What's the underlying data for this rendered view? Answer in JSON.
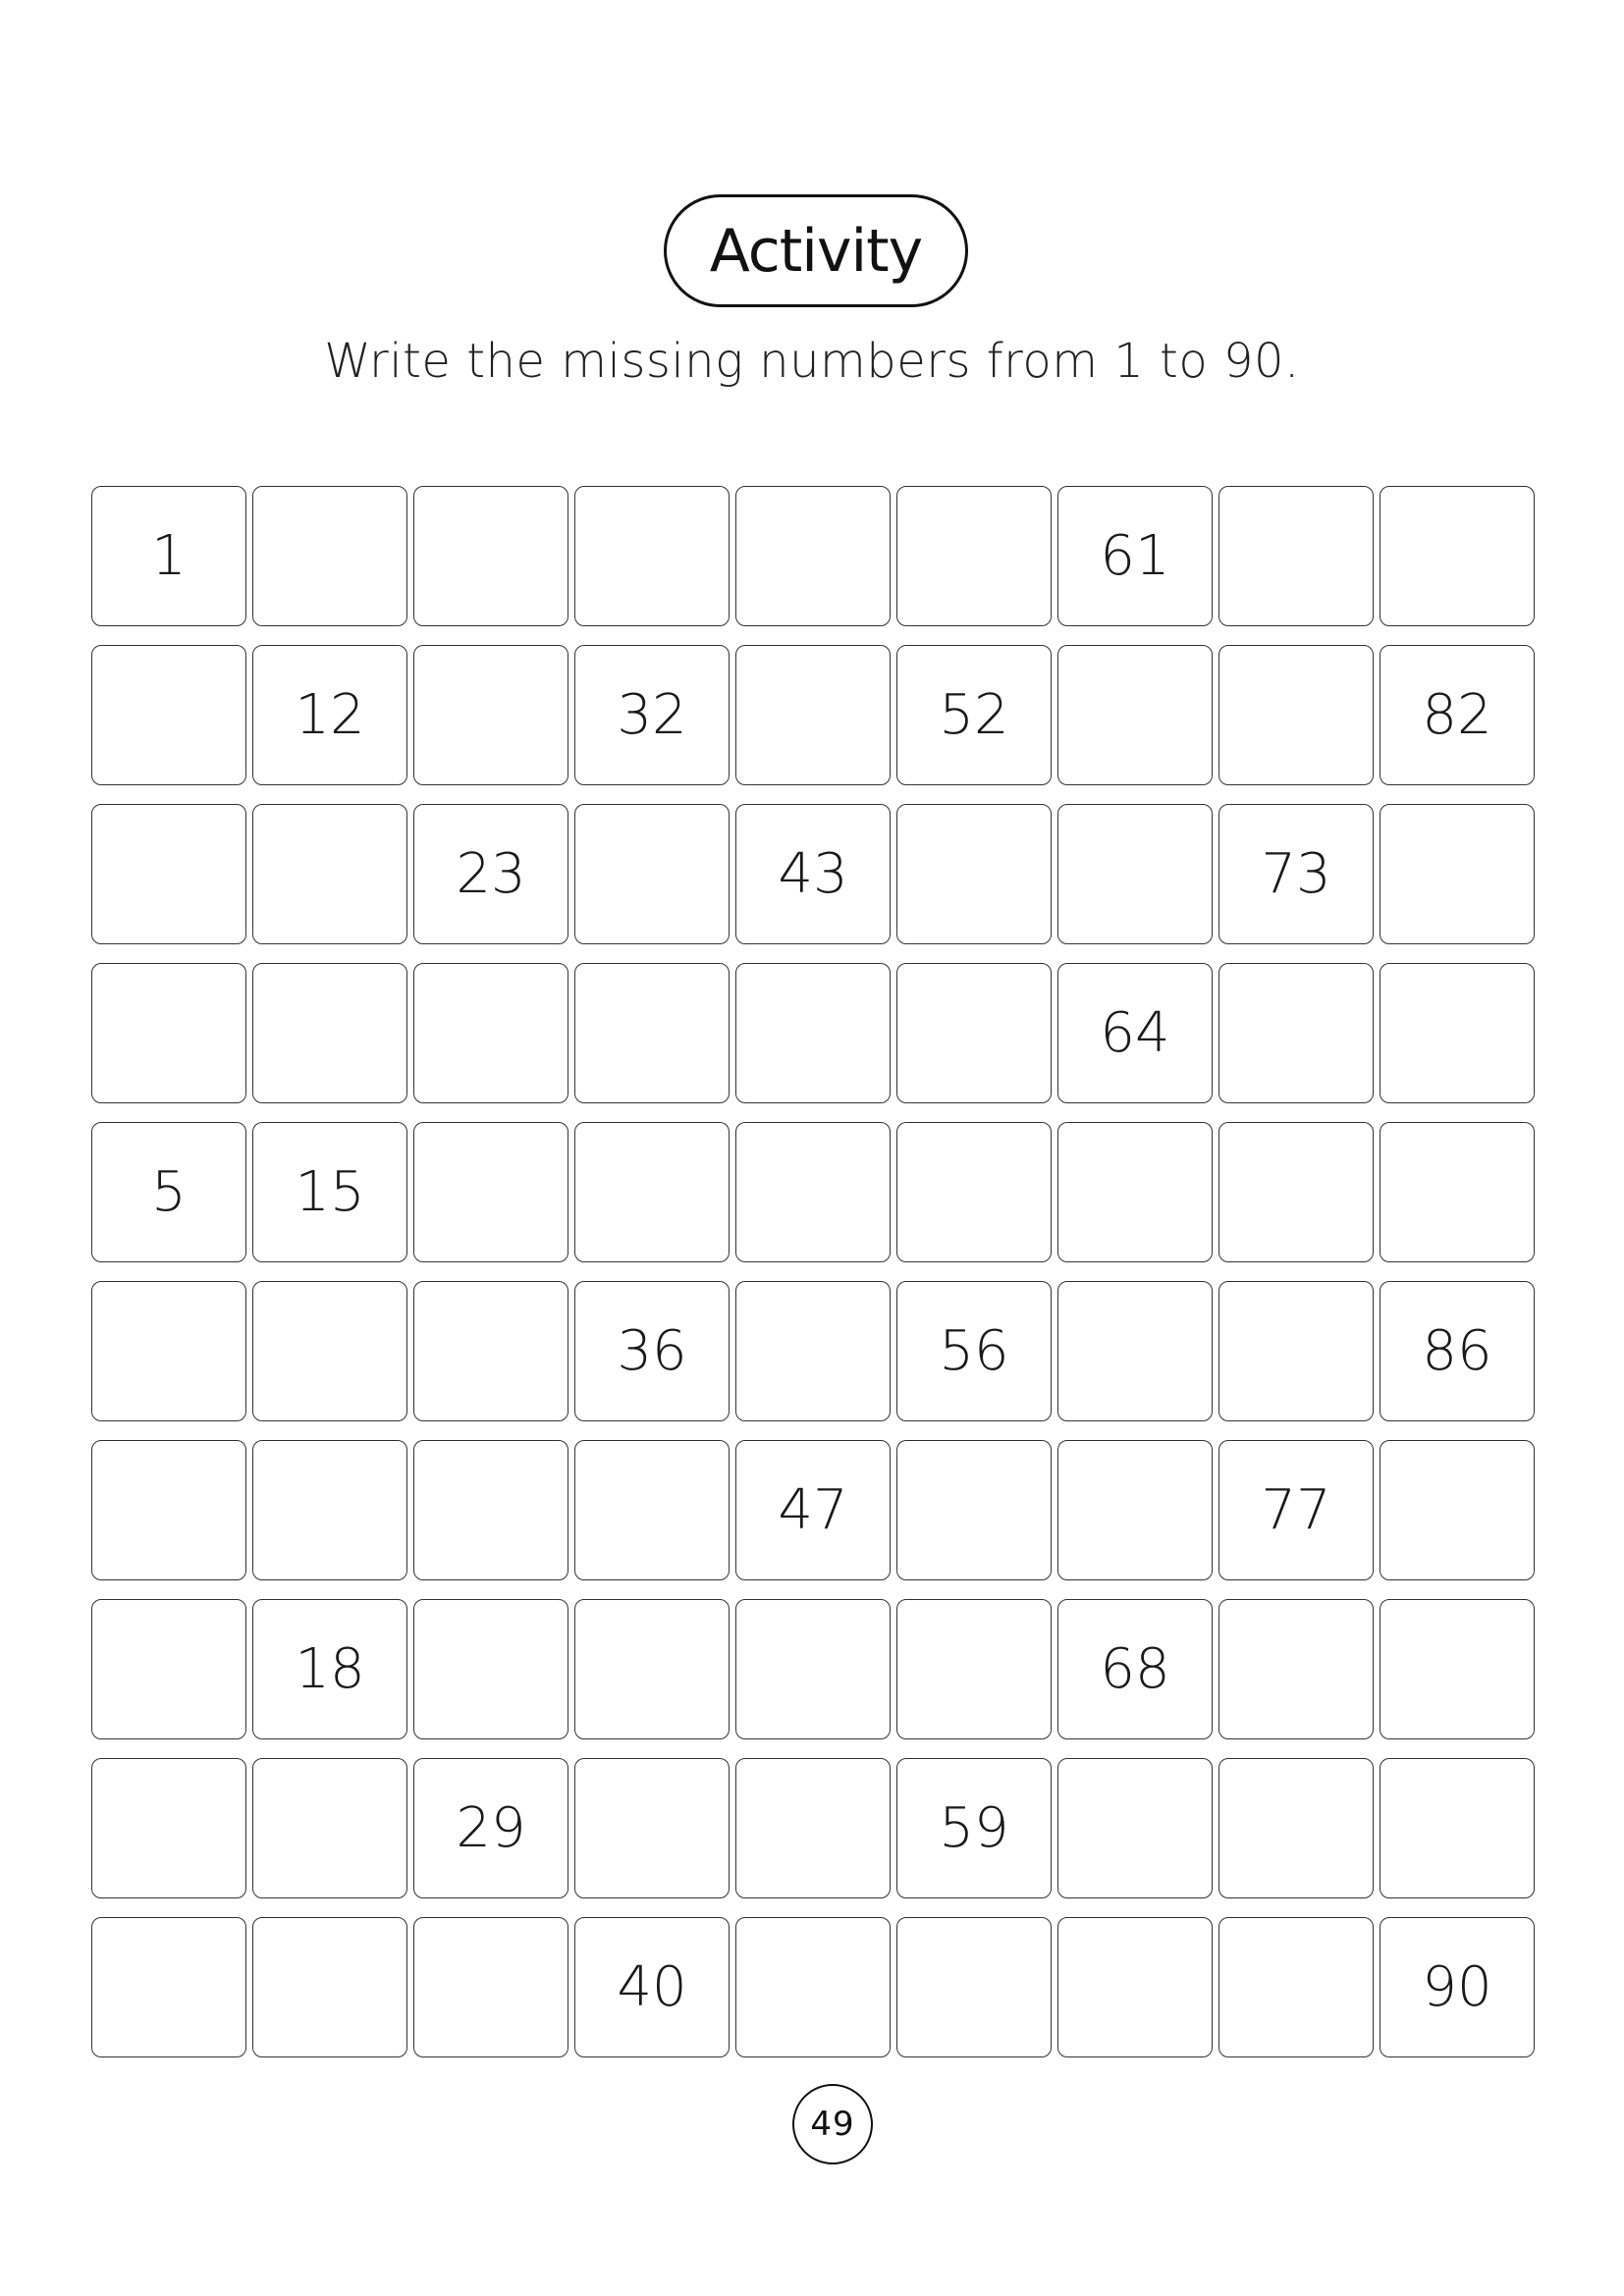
{
  "header": {
    "title": "Activity",
    "instruction": "Write the missing numbers from 1 to 90."
  },
  "number_grid": {
    "columns": 9,
    "rows": [
      [
        "1",
        "",
        "",
        "",
        "",
        "",
        "61",
        "",
        ""
      ],
      [
        "",
        "12",
        "",
        "32",
        "",
        "52",
        "",
        "",
        "82"
      ],
      [
        "",
        "",
        "23",
        "",
        "43",
        "",
        "",
        "73",
        ""
      ],
      [
        "",
        "",
        "",
        "",
        "",
        "",
        "64",
        "",
        ""
      ],
      [
        "5",
        "15",
        "",
        "",
        "",
        "",
        "",
        "",
        ""
      ],
      [
        "",
        "",
        "",
        "36",
        "",
        "56",
        "",
        "",
        "86"
      ],
      [
        "",
        "",
        "",
        "",
        "47",
        "",
        "",
        "77",
        ""
      ],
      [
        "",
        "18",
        "",
        "",
        "",
        "",
        "68",
        "",
        ""
      ],
      [
        "",
        "",
        "29",
        "",
        "",
        "59",
        "",
        "",
        ""
      ],
      [
        "",
        "",
        "",
        "40",
        "",
        "",
        "",
        "",
        "90"
      ]
    ]
  },
  "footer": {
    "page_number": "49"
  }
}
